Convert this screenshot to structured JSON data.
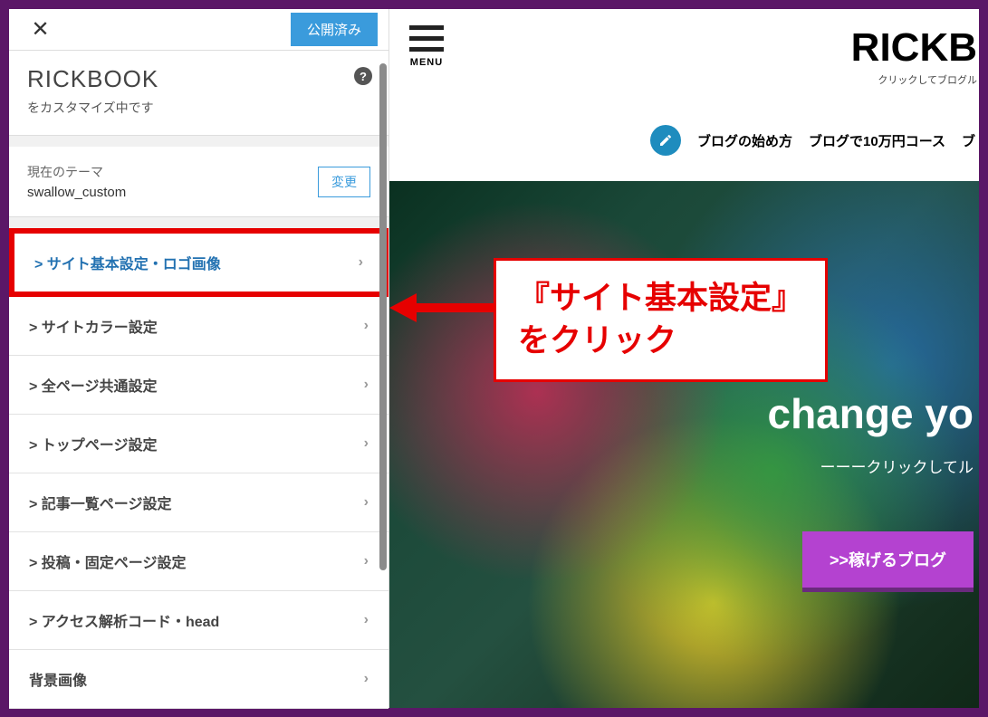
{
  "sidebar": {
    "publish_label": "公開済み",
    "site_name": "RICKBOOK",
    "customize_text": "をカスタマイズ中です",
    "theme_label": "現在のテーマ",
    "theme_name": "swallow_custom",
    "change_label": "変更",
    "items": [
      {
        "label": "> サイト基本設定・ロゴ画像",
        "highlighted": true
      },
      {
        "label": "> サイトカラー設定"
      },
      {
        "label": "> 全ページ共通設定"
      },
      {
        "label": "> トップページ設定"
      },
      {
        "label": "> 記事一覧ページ設定"
      },
      {
        "label": "> 投稿・固定ページ設定"
      },
      {
        "label": "> アクセス解析コード・head"
      },
      {
        "label": "背景画像"
      }
    ]
  },
  "preview": {
    "menu_label": "MENU",
    "logo": "RICKB",
    "tagline": "クリックしてブログル",
    "nav": [
      "ブログの始め方",
      "ブログで10万円コース",
      "ブ"
    ],
    "hero_title": "change yo",
    "hero_sub": "ーーークリックしてル",
    "hero_btn": ">>稼げるブログ"
  },
  "annotation": {
    "text": "『サイト基本設定』\nをクリック"
  }
}
